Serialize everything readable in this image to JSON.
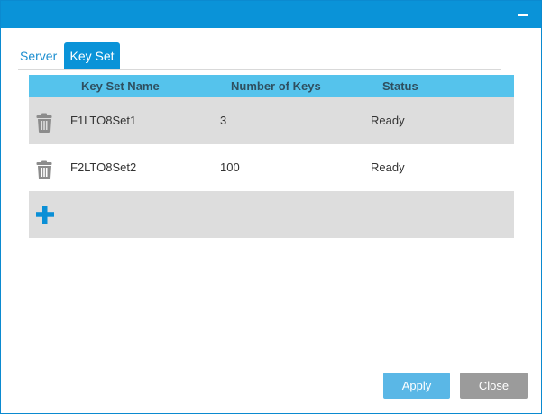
{
  "tabs": [
    {
      "label": "Server",
      "active": false
    },
    {
      "label": "Key Set",
      "active": true
    }
  ],
  "table": {
    "headers": {
      "name": "Key Set Name",
      "keys": "Number of Keys",
      "status": "Status"
    },
    "rows": [
      {
        "name": "F1LTO8Set1",
        "keys": "3",
        "status": "Ready"
      },
      {
        "name": "F2LTO8Set2",
        "keys": "100",
        "status": "Ready"
      }
    ]
  },
  "buttons": {
    "apply": "Apply",
    "close": "Close"
  },
  "icons": {
    "minimize": "minimize-icon",
    "delete": "trash-icon",
    "add": "plus-icon"
  },
  "colors": {
    "accent": "#0a93d8",
    "header": "#55c3ec",
    "row_alt": "#dddddd",
    "apply": "#5ab7e6",
    "close": "#9b9b9b",
    "trash": "#8c8c8c"
  }
}
